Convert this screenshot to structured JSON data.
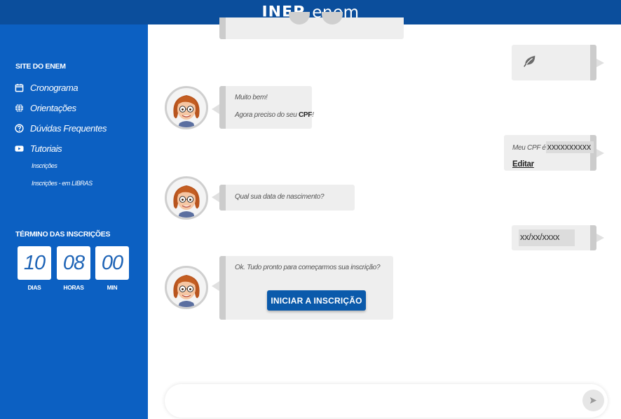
{
  "header": {
    "logo_inep": "INEP",
    "logo_enem": "enem"
  },
  "sidebar": {
    "heading": "SITE DO ENEM",
    "items": [
      {
        "label": "Cronograma",
        "icon": "calendar-icon"
      },
      {
        "label": "Orientações",
        "icon": "globe-icon"
      },
      {
        "label": "Dúvidas Frequentes",
        "icon": "question-circle-icon"
      },
      {
        "label": "Tutoriais",
        "icon": "youtube-play-icon"
      }
    ],
    "subitems": [
      {
        "label": "Inscrições"
      },
      {
        "label": "Inscrições - em LIBRAS"
      }
    ],
    "countdown": {
      "heading": "TÉRMINO DAS INSCRIÇÕES",
      "days": "10",
      "hours": "08",
      "minutes": "00",
      "days_label": "DIAS",
      "hours_label": "HORAS",
      "minutes_label": "MIN"
    }
  },
  "chat": {
    "msg_bot_1_line1": "Muito bem!",
    "msg_bot_1_line2_prefix": "Agora preciso do seu ",
    "msg_bot_1_line2_bold": "CPF",
    "msg_bot_1_line2_suffix": "!",
    "msg_user_cpf_prefix": "Meu CPF é",
    "msg_user_cpf_value": "xxxxxxxxxx",
    "edit_label": "Editar",
    "msg_bot_2": "Qual sua data de nascimento?",
    "msg_user_date": "xx/xx/xxxx",
    "msg_bot_3": "Ok. Tudo pronto para começarmos sua inscrição?",
    "start_button": "INICIAR A INSCRIÇÃO",
    "input_placeholder": ""
  },
  "colors": {
    "header_bg": "#0b4e9c",
    "sidebar_bg": "#0c60c2",
    "button_bg": "#0b5aab",
    "bubble_bg": "#eeeeee",
    "bubble_accent": "#cccccc"
  }
}
